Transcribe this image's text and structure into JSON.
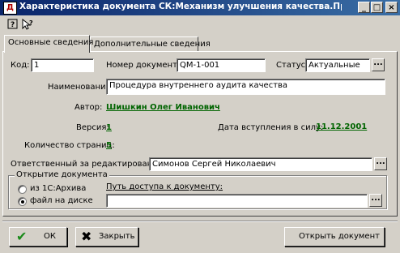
{
  "window": {
    "title": "Характеристика документа СК:Механизм улучшения качества.Процедура.Вну",
    "minimize_glyph": "_",
    "maximize_glyph": "□",
    "close_glyph": "×"
  },
  "toolbar": {
    "icon1": "help-icon",
    "icon2": "pointer-help-icon"
  },
  "tabs": [
    {
      "label": "Основные сведения",
      "active": true
    },
    {
      "label": "Дополнительные сведения",
      "active": false
    }
  ],
  "form": {
    "code_label": "Код:",
    "code_value": "1",
    "docnum_label": "Номер документа:",
    "docnum_value": "QM-1-001",
    "status_label": "Статус:",
    "status_value": "Актуальные",
    "name_label": "Наименование:",
    "name_value": "Процедура внутреннего аудита качества",
    "author_label": "Автор:",
    "author_value": "Шишкин Олег Иванович",
    "version_label": "Версия:",
    "version_value": "1",
    "effective_label": "Дата вступления в силу:",
    "effective_value": "11.12.2001",
    "pages_label": "Количество страниц:",
    "pages_value": "5",
    "editor_label": "Ответственный за редактирование:",
    "editor_value": "Симонов Сергей Николаевич",
    "dots": "..."
  },
  "open_group": {
    "title": "Открытие документа",
    "option1": "из 1С:Архива",
    "option2": "файл на диске",
    "selected": "option2",
    "path_label": "Путь доступа к документу:",
    "path_value": ""
  },
  "buttons": {
    "ok": "ОК",
    "close": "Закрыть",
    "open_doc": "Открыть документ"
  },
  "colors": {
    "title_bar_start": "#0a246a",
    "title_bar_end": "#3a6ea5",
    "link": "#006400"
  }
}
